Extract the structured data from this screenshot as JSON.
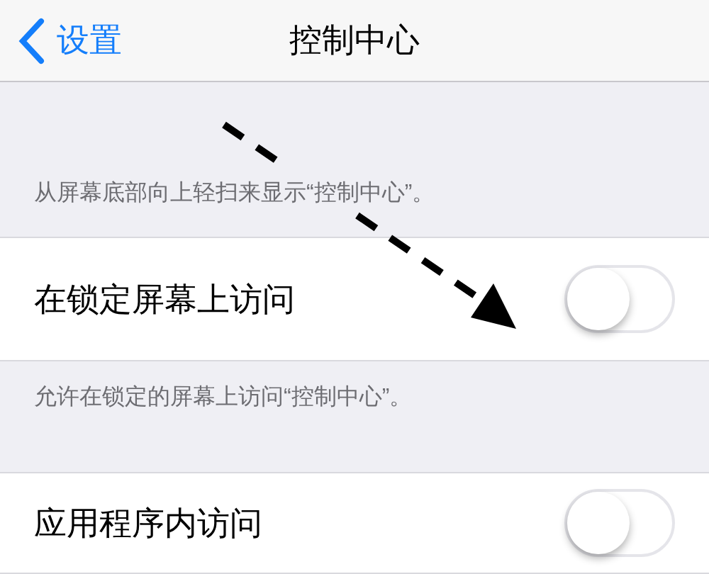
{
  "nav_bar": {
    "back": "设置",
    "title": "控制中心"
  },
  "intro_note": "从屏幕底部向上轻扫来显示“控制中心”。",
  "settings": [
    {
      "label": "在锁定屏幕上访问",
      "on": false,
      "note": "允许在锁定的屏幕上访问“控制中心”。"
    },
    {
      "label": "应用程序内访问",
      "on": false
    }
  ]
}
